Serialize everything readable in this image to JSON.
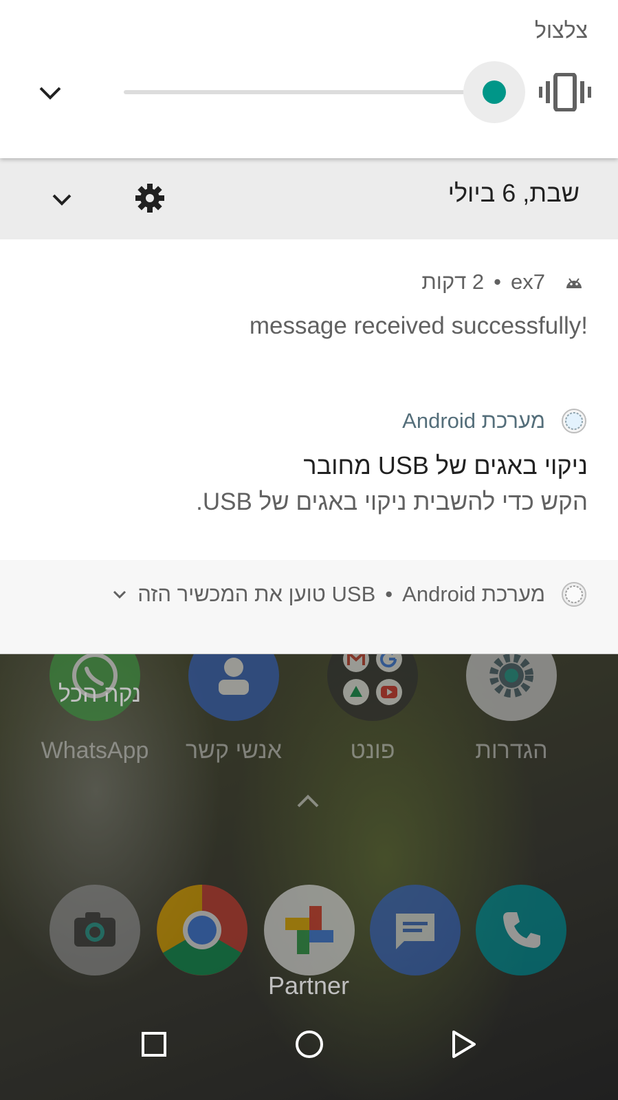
{
  "volume_panel": {
    "title": "צלצול",
    "level": 1.0,
    "accent_color": "#009688",
    "mode_icon": "vibrate-icon",
    "collapse_icon": "chevron-down-icon"
  },
  "shade": {
    "date": "שבת, 6 ביולי",
    "settings_icon": "gear-icon",
    "expand_icon": "chevron-down-icon"
  },
  "notifications": [
    {
      "app_icon": "android-icon",
      "app_name": "ex7",
      "separator": "•",
      "time": "2 דקות",
      "text": "message received successfully!"
    },
    {
      "app_icon": "android-system-icon",
      "app_name": "מערכת Android",
      "title": "ניקוי באגים של USB מחובר",
      "text": "הקש כדי להשבית ניקוי באגים של USB."
    },
    {
      "app_icon": "android-system-icon",
      "app_name": "מערכת Android",
      "separator": "•",
      "summary": "USB טוען את המכשיר הזה",
      "expand_icon": "chevron-down-icon"
    }
  ],
  "clear_all": "נקה הכל",
  "home": {
    "apps": [
      {
        "label": "WhatsApp",
        "icon": "whatsapp-icon"
      },
      {
        "label": "אנשי קשר",
        "icon": "contacts-icon"
      },
      {
        "label": "פונט",
        "icon": "google-folder-icon"
      },
      {
        "label": "הגדרות",
        "icon": "settings-icon"
      }
    ],
    "dock": [
      {
        "icon": "camera-icon"
      },
      {
        "icon": "chrome-icon"
      },
      {
        "icon": "photos-icon"
      },
      {
        "icon": "messages-icon"
      },
      {
        "icon": "phone-icon"
      }
    ],
    "carrier": "Partner"
  },
  "navbar": {
    "recents_icon": "square-icon",
    "home_icon": "circle-icon",
    "back_icon": "triangle-icon"
  }
}
